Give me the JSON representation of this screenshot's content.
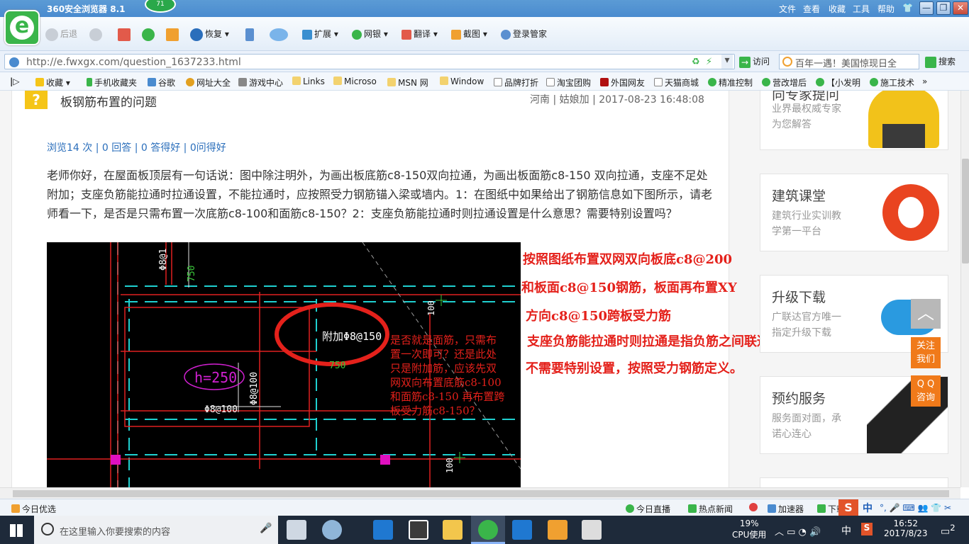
{
  "browser": {
    "title": "360安全浏览器 8.1",
    "score": "71",
    "menu": [
      "文件",
      "查看",
      "收藏",
      "工具",
      "帮助"
    ]
  },
  "toolbar": {
    "back": "后退",
    "restore": "恢复",
    "extensions": "扩展",
    "netbank": "网银",
    "translate": "翻译",
    "screenshot": "截图",
    "login_manager": "登录管家"
  },
  "address": {
    "url": "http://e.fwxgx.com/question_1637233.html",
    "go_label": "访问",
    "search_placeholder": "百年一遇！美国惊现日全",
    "search_button": "搜索"
  },
  "bookmarks": [
    "收藏",
    "手机收藏夹",
    "谷歌",
    "网址大全",
    "游戏中心",
    "Links",
    "Microso",
    "MSN 网",
    "Window",
    "品牌打折",
    "淘宝团购",
    "外国网友",
    "天猫商城",
    "精准控制",
    "营改增后",
    "【小发明",
    "施工技术"
  ],
  "question": {
    "icon": "?",
    "title": "板钢筋布置的问题",
    "meta": "河南 | 姑娘加 | 2017-08-23 16:48:08",
    "stats": "浏览14 次 | 0 回答 | 0 答得好 | 0问得好",
    "body": "老师你好，在屋面板顶层有一句话说：图中除注明外，为画出板底筋c8-150双向拉通，为画出板面筋c8-150 双向拉通，支座不足处附加；支座负筋能拉通时拉通设置，不能拉通时，应按照受力钢筋锚入梁或墙内。1：在图纸中如果给出了钢筋信息如下图所示，请老师看一下，是否是只需布置一次底筋c8-100和面筋c8-150？2：支座负筋能拉通时则拉通设置是什么意思？需要特别设置吗？"
  },
  "drawing": {
    "labels": {
      "top_rebar": "Φ8@1",
      "len750a": "750",
      "len750b": "750",
      "len100a": "100",
      "len100b": "100",
      "h250": "h=250",
      "circle_text": "附加Φ8@150",
      "bottom_rebar": "Φ8@100",
      "vert_rebar": "Φ8@100"
    },
    "note": [
      "是否就是面筋，只需布",
      "置一次即可？还是此处",
      "只是附加筋，应该先双",
      "网双向布置底筋c8-100",
      "和面筋c8-150 再布置跨",
      "板受力筋c8-150？"
    ]
  },
  "answer": [
    "按照图纸布置双网双向板底c8@200",
    "和板面c8@150钢筋，板面再布置XY",
    "方向c8@150跨板受力筋",
    "支座负筋能拉通时则拉通是指负筋之间联通通长",
    "不需要特别设置，按照受力钢筋定义。"
  ],
  "sidebar": [
    {
      "heading": "向专家提问",
      "sub": [
        "业界最权威专家",
        "为您解答"
      ]
    },
    {
      "heading": "建筑课堂",
      "sub": [
        "建筑行业实训教",
        "学第一平台"
      ]
    },
    {
      "heading": "升级下载",
      "sub": [
        "广联达官方唯一",
        "指定升级下载"
      ]
    },
    {
      "heading": "预约服务",
      "sub": [
        "服务面对面，承",
        "诺心连心"
      ]
    }
  ],
  "float_buttons": {
    "follow": [
      "关注",
      "我们"
    ],
    "qq": [
      "Q Q",
      "咨询"
    ]
  },
  "statusbar": {
    "left": "今日优选",
    "live": "今日直播",
    "news": "热点新闻",
    "accelerator": "加速器",
    "download": "下载",
    "ime": "中"
  },
  "taskbar": {
    "search_placeholder": "在这里输入你要搜索的内容",
    "cpu_percent": "19%",
    "cpu_label": "CPU使用",
    "ime": "中",
    "time": "16:52",
    "date": "2017/8/23",
    "notifications": "2"
  },
  "colors": {
    "accent": "#e4211b",
    "link": "#2a6ebb",
    "brand": "#3ab54a"
  }
}
